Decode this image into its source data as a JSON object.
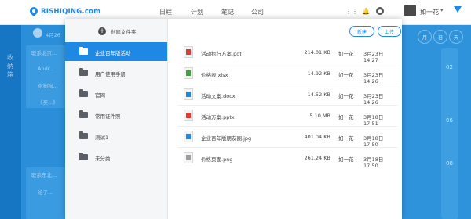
{
  "app": {
    "logo_text": "RISHIQING.com",
    "nav": [
      "日程",
      "计划",
      "笔记",
      "公司"
    ],
    "username": "如一花",
    "brand_color": "#1e88e5"
  },
  "background": {
    "sidebar_text": "收纳箱",
    "date_header": "4月26",
    "left_rows": [
      "联系北京...",
      "Andr...",
      "给狗狗...",
      "《买...》",
      "联系东北...",
      "给子..."
    ],
    "right_pills": [
      "月",
      "日",
      "天"
    ],
    "right_numbers": [
      "02",
      "06",
      "08"
    ]
  },
  "modal": {
    "create_folder_label": "创建文件夹",
    "folders": [
      {
        "label": "企业百年版活动",
        "active": true
      },
      {
        "label": "用户使用手册",
        "active": false
      },
      {
        "label": "官网",
        "active": false
      },
      {
        "label": "常用证件照",
        "active": false
      },
      {
        "label": "测试1",
        "active": false
      },
      {
        "label": "未分类",
        "active": false
      }
    ],
    "buttons": {
      "new": "新建",
      "upload": "上传"
    },
    "files": [
      {
        "name": "活动执行方案.pdf",
        "size": "214.01 KB",
        "owner": "如一花",
        "date": "3月23日 14:27",
        "icon": "pdf-icon",
        "color": "#e53935"
      },
      {
        "name": "价格表.xlsx",
        "size": "14.92 KB",
        "owner": "如一花",
        "date": "3月23日 14:26",
        "icon": "spreadsheet-icon",
        "color": "#43a047"
      },
      {
        "name": "活动文案.docx",
        "size": "14.52 KB",
        "owner": "如一花",
        "date": "3月23日 14:26",
        "icon": "document-icon",
        "color": "#1e88e5"
      },
      {
        "name": "活动方案.pptx",
        "size": "5.10 MB",
        "owner": "如一花",
        "date": "3月18日 17:51",
        "icon": "presentation-icon",
        "color": "#e53935"
      },
      {
        "name": "企业百年版朋友圈.jpg",
        "size": "401.04 KB",
        "owner": "如一花",
        "date": "3月18日 17:50",
        "icon": "image-icon",
        "color": "#1e88e5"
      },
      {
        "name": "价格页面.png",
        "size": "261.24 KB",
        "owner": "如一花",
        "date": "3月18日 17:50",
        "icon": "image-icon",
        "color": "#9e9e9e"
      }
    ]
  }
}
